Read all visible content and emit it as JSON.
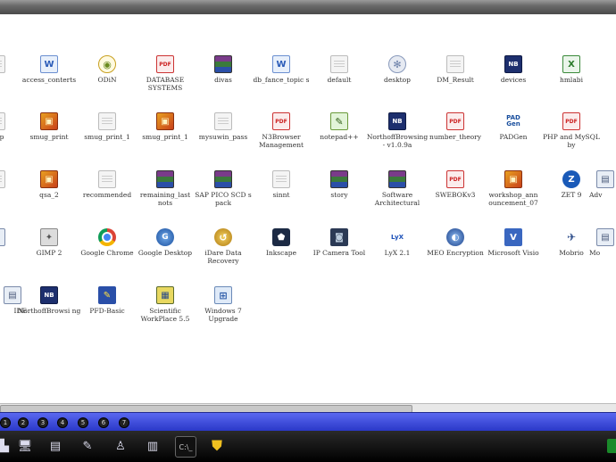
{
  "desktop": {
    "icons": [
      {
        "label": "",
        "icon": "document-icon"
      },
      {
        "label": "access_conterts",
        "icon": "word-icon"
      },
      {
        "label": "ODiN",
        "icon": "odin-icon"
      },
      {
        "label": "DATABASE SYSTEMS",
        "icon": "pdf-icon"
      },
      {
        "label": "divas",
        "icon": "rar-icon"
      },
      {
        "label": "db_fance_topic s",
        "icon": "word-icon"
      },
      {
        "label": "default",
        "icon": "document-icon"
      },
      {
        "label": "desktop",
        "icon": "gear-icon"
      },
      {
        "label": "DM_Result",
        "icon": "document-icon"
      },
      {
        "label": "devices",
        "icon": "nb-icon"
      },
      {
        "label": "hmlabi",
        "icon": "xls-icon"
      },
      {
        "label": "ktop",
        "icon": "document-icon"
      },
      {
        "label": "smug_print",
        "icon": "bitmap-icon"
      },
      {
        "label": "smug_print_1",
        "icon": "document-icon"
      },
      {
        "label": "smug_print_1",
        "icon": "bitmap-icon"
      },
      {
        "label": "mysuwin_pass",
        "icon": "document-icon"
      },
      {
        "label": "N3Browser Management",
        "icon": "pdf-icon"
      },
      {
        "label": "notepad++",
        "icon": "notepad-icon"
      },
      {
        "label": "NorthoffBrowsing - v1.0.9a",
        "icon": "nb-icon"
      },
      {
        "label": "number_theory",
        "icon": "pdf-icon"
      },
      {
        "label": "PADGen",
        "icon": "pad-icon"
      },
      {
        "label": "PHP and MySQL by",
        "icon": "pdf-icon"
      },
      {
        "label": "",
        "icon": "document-icon"
      },
      {
        "label": "qsa_2",
        "icon": "bitmap-icon"
      },
      {
        "label": "recommended",
        "icon": "document-icon"
      },
      {
        "label": "remaining_last nots",
        "icon": "rar-icon"
      },
      {
        "label": "SAP PICO SCD s pack",
        "icon": "rar-icon"
      },
      {
        "label": "sinnt",
        "icon": "document-icon"
      },
      {
        "label": "story",
        "icon": "rar-icon"
      },
      {
        "label": "Software Architectural",
        "icon": "rar-icon"
      },
      {
        "label": "SWEBOKv3",
        "icon": "pdf-icon"
      },
      {
        "label": "workshop_ann ouncement_07",
        "icon": "bitmap-icon"
      },
      {
        "label": "ZET 9",
        "icon": "zet-icon"
      },
      {
        "label": "Adv",
        "icon": "generic-icon"
      },
      {
        "label": "D",
        "icon": "generic-icon"
      },
      {
        "label": "GIMP 2",
        "icon": "gimp-icon"
      },
      {
        "label": "Google Chrome",
        "icon": "chrome-icon"
      },
      {
        "label": "Google Desktop",
        "icon": "gdesktop-icon"
      },
      {
        "label": "iDare Data Recovery",
        "icon": "idare-icon"
      },
      {
        "label": "Inkscape",
        "icon": "inkscape-icon"
      },
      {
        "label": "IP Camera Tool",
        "icon": "camera-icon"
      },
      {
        "label": "LyX 2.1",
        "icon": "lyx-icon"
      },
      {
        "label": "MEO Encryption",
        "icon": "meo-icon"
      },
      {
        "label": "Microsoft Visio",
        "icon": "visio-icon"
      },
      {
        "label": "Mobrio",
        "icon": "mobrio-icon"
      },
      {
        "label": "Mo",
        "icon": "generic-icon"
      },
      {
        "label": "IDE",
        "icon": "generic-icon"
      },
      {
        "label": "NorthoffBrowsi ng",
        "icon": "nb-icon"
      },
      {
        "label": "PFD-Basic",
        "icon": "pfd-icon"
      },
      {
        "label": "Scientific WorkPlace 5.5",
        "icon": "scientific-icon"
      },
      {
        "label": "Windows 7 Upgrade",
        "icon": "win7-icon"
      }
    ]
  },
  "status_bar": {
    "dots": [
      "1",
      "2",
      "3",
      "4",
      "5",
      "6",
      "7",
      "8"
    ]
  },
  "taskbar": {
    "cmd_label": "C:\\_"
  }
}
